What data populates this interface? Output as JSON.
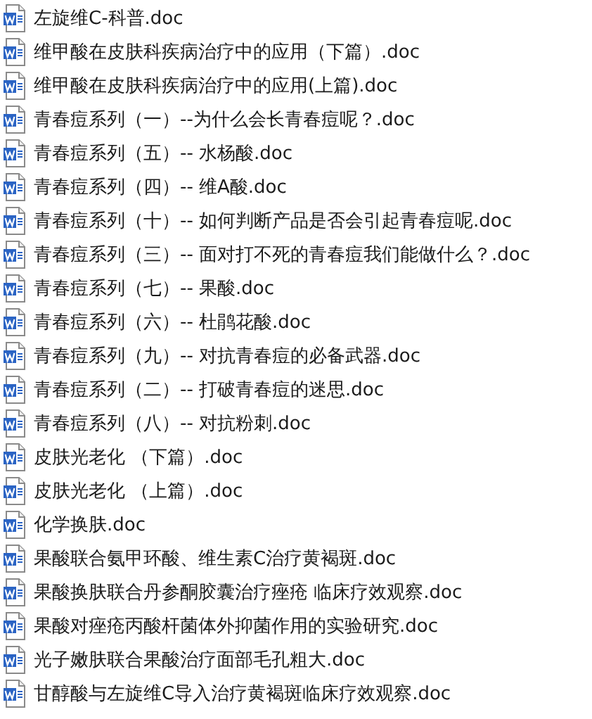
{
  "files": [
    {
      "name": "左旋维C-科普.doc"
    },
    {
      "name": "维甲酸在皮肤科疾病治疗中的应用（下篇）.doc"
    },
    {
      "name": "维甲酸在皮肤科疾病治疗中的应用(上篇).doc"
    },
    {
      "name": "青春痘系列（一）--为什么会长青春痘呢？.doc"
    },
    {
      "name": "青春痘系列（五）-- 水杨酸.doc"
    },
    {
      "name": "青春痘系列（四）-- 维A酸.doc"
    },
    {
      "name": "青春痘系列（十）-- 如何判断产品是否会引起青春痘呢.doc"
    },
    {
      "name": "青春痘系列（三）-- 面对打不死的青春痘我们能做什么？.doc"
    },
    {
      "name": "青春痘系列（七）-- 果酸.doc"
    },
    {
      "name": "青春痘系列（六）-- 杜鹃花酸.doc"
    },
    {
      "name": "青春痘系列（九）-- 对抗青春痘的必备武器.doc"
    },
    {
      "name": "青春痘系列（二）-- 打破青春痘的迷思.doc"
    },
    {
      "name": "青春痘系列（八）-- 对抗粉刺.doc"
    },
    {
      "name": "皮肤光老化 （下篇）.doc"
    },
    {
      "name": "皮肤光老化 （上篇）.doc"
    },
    {
      "name": "化学换肤.doc"
    },
    {
      "name": "果酸联合氨甲环酸、维生素C治疗黄褐斑.doc"
    },
    {
      "name": "果酸换肤联合丹参酮胶囊治疗痤疮 临床疗效观察.doc"
    },
    {
      "name": "果酸对痤疮丙酸杆菌体外抑菌作用的实验研究.doc"
    },
    {
      "name": "光子嫩肤联合果酸治疗面部毛孔粗大.doc"
    },
    {
      "name": "甘醇酸与左旋维C导入治疗黄褐斑临床疗效观察.doc"
    }
  ]
}
